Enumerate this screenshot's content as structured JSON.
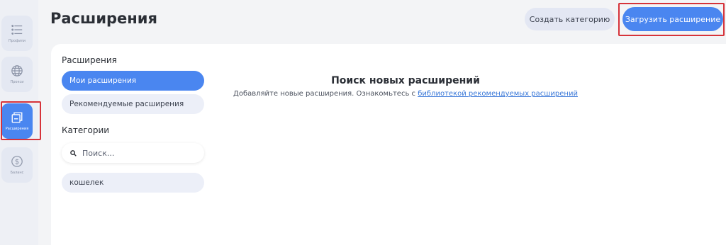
{
  "sidebar": {
    "items": [
      {
        "label": "Профили",
        "icon": "list-icon"
      },
      {
        "label": "Прокси",
        "icon": "globe-icon"
      },
      {
        "label": "Расширения",
        "icon": "extensions-icon",
        "active": true
      },
      {
        "label": "Баланс",
        "icon": "dollar-icon"
      }
    ]
  },
  "header": {
    "title": "Расширения",
    "create_category_label": "Создать категорию",
    "upload_extension_label": "Загрузить расширение"
  },
  "filters": {
    "extensions_heading": "Расширения",
    "my_extensions": "Мои расширения",
    "recommended": "Рекомендуемые расширения",
    "categories_heading": "Категории",
    "search_placeholder": "Поиск...",
    "category_items": [
      "кошелек"
    ]
  },
  "main": {
    "empty_title": "Поиск новых расширений",
    "empty_text": "Добавляйте новые расширения. Ознакомьтесь с",
    "empty_link": "библиотекой рекомендуемых расширений"
  },
  "colors": {
    "accent": "#4a86f0",
    "highlight": "#d6333a"
  }
}
